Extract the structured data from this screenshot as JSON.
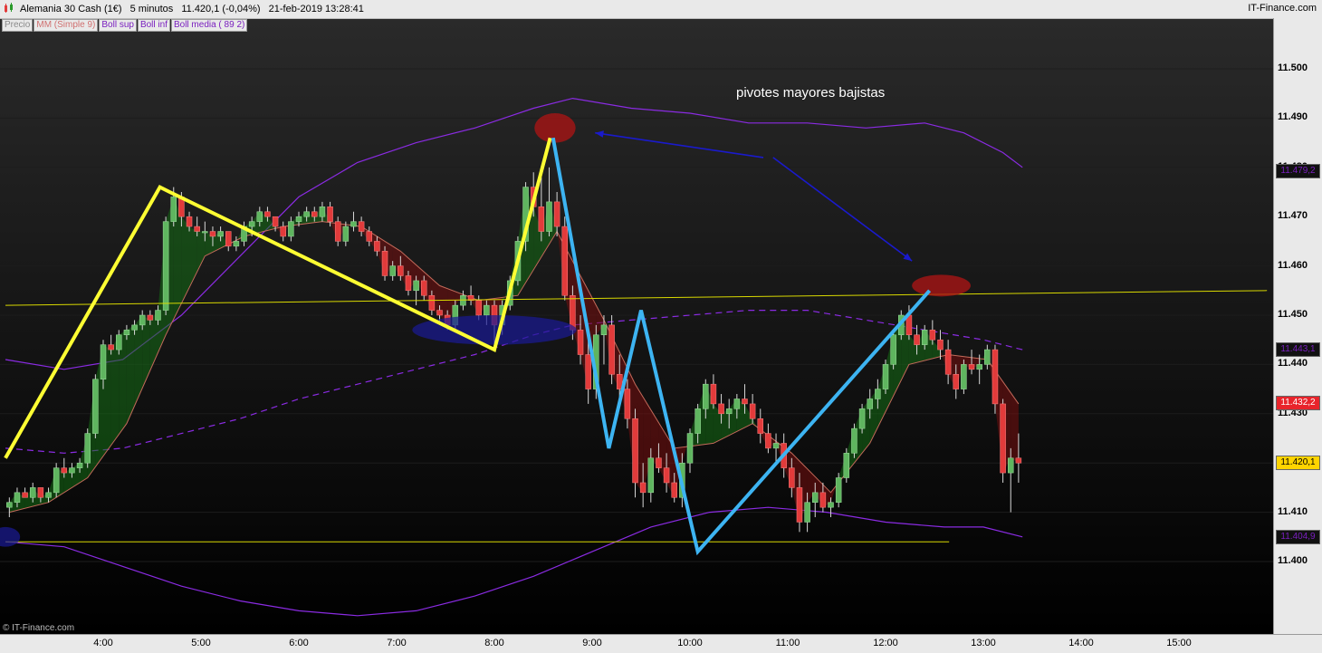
{
  "header": {
    "title": "Alemania 30 Cash (1€)",
    "timeframe": "5 minutos",
    "last": "11.420,1 (-0,04%)",
    "datetime": "21-feb-2019 13:28:41",
    "brand": "IT-Finance.com"
  },
  "legend": {
    "items": [
      {
        "label": "Precio",
        "color": "#8a8a8a"
      },
      {
        "label": "MM (Simple 9)",
        "color": "#d07070"
      },
      {
        "label": "Boll sup",
        "color": "#7a1fbf"
      },
      {
        "label": "Boll inf",
        "color": "#7a1fbf"
      },
      {
        "label": "Boll media ( 89 2)",
        "color": "#7a1fbf"
      }
    ]
  },
  "annotation": "pivotes mayores bajistas",
  "credit": "© IT-Finance.com",
  "colors": {
    "up": "#5fb55f",
    "down": "#e23b3b",
    "boll": "#8a2be2",
    "zigzag_yellow": "#ffff33",
    "zigzag_blue": "#3db4f2",
    "arrow": "#1a1acc",
    "support": "#d8d800"
  },
  "chart_data": {
    "type": "candlestick",
    "symbol": "Alemania 30 Cash (1€)",
    "interval": "5 minutos",
    "y_ticks": [
      "11.500",
      "11.490",
      "11.480",
      "11.470",
      "11.460",
      "11.450",
      "11.440",
      "11.430",
      "11.420",
      "11.410",
      "11.400"
    ],
    "ylim": [
      11389,
      11518
    ],
    "x_ticks": [
      "4:00",
      "5:00",
      "6:00",
      "7:00",
      "8:00",
      "9:00",
      "10:00",
      "11:00",
      "12:00",
      "13:00",
      "14:00",
      "15:00"
    ],
    "x_tick_hours": [
      4,
      5,
      6,
      7,
      8,
      9,
      10,
      11,
      12,
      13,
      14,
      15
    ],
    "xlim": [
      3.0,
      16.0
    ],
    "price_tags": [
      {
        "label": "11.479,2",
        "value": 11479.2,
        "bg": "#111111",
        "fg": "#7a1fbf"
      },
      {
        "label": "11.443,1",
        "value": 11443.1,
        "bg": "#111111",
        "fg": "#7a1fbf"
      },
      {
        "label": "11.432,2",
        "value": 11432.2,
        "bg": "#e8242b",
        "fg": "#ffffff"
      },
      {
        "label": "11.420,1",
        "value": 11420.1,
        "bg": "#ffd400",
        "fg": "#000000"
      },
      {
        "label": "11.404,9",
        "value": 11404.9,
        "bg": "#111111",
        "fg": "#7a1fbf"
      }
    ],
    "candles": [
      [
        3.04,
        11411,
        11413,
        11409,
        11412
      ],
      [
        3.12,
        11412,
        11415,
        11411,
        11414
      ],
      [
        3.2,
        11414,
        11415,
        11413,
        11413
      ],
      [
        3.28,
        11413,
        11416,
        11412,
        11415
      ],
      [
        3.36,
        11415,
        11415,
        11412,
        11413
      ],
      [
        3.44,
        11413,
        11415,
        11412,
        11414
      ],
      [
        3.52,
        11414,
        11420,
        11413,
        11419
      ],
      [
        3.6,
        11419,
        11421,
        11417,
        11418
      ],
      [
        3.68,
        11418,
        11420,
        11417,
        11419
      ],
      [
        3.76,
        11419,
        11421,
        11418,
        11420
      ],
      [
        3.84,
        11420,
        11427,
        11419,
        11426
      ],
      [
        3.92,
        11426,
        11438,
        11425,
        11437
      ],
      [
        4.0,
        11437,
        11445,
        11435,
        11444
      ],
      [
        4.08,
        11444,
        11446,
        11442,
        11443
      ],
      [
        4.16,
        11443,
        11447,
        11442,
        11446
      ],
      [
        4.24,
        11446,
        11448,
        11445,
        11447
      ],
      [
        4.32,
        11447,
        11449,
        11446,
        11448
      ],
      [
        4.4,
        11448,
        11451,
        11447,
        11450
      ],
      [
        4.48,
        11450,
        11451,
        11448,
        11449
      ],
      [
        4.56,
        11449,
        11452,
        11448,
        11451
      ],
      [
        4.64,
        11451,
        11470,
        11450,
        11469
      ],
      [
        4.72,
        11469,
        11476,
        11468,
        11474
      ],
      [
        4.8,
        11474,
        11475,
        11468,
        11470
      ],
      [
        4.88,
        11470,
        11471,
        11467,
        11468
      ],
      [
        4.96,
        11468,
        11470,
        11466,
        11467
      ],
      [
        5.04,
        11467,
        11469,
        11465,
        11467
      ],
      [
        5.12,
        11467,
        11468,
        11464,
        11466
      ],
      [
        5.2,
        11466,
        11468,
        11465,
        11467
      ],
      [
        5.28,
        11467,
        11467,
        11463,
        11464
      ],
      [
        5.36,
        11464,
        11466,
        11463,
        11465
      ],
      [
        5.44,
        11465,
        11469,
        11464,
        11468
      ],
      [
        5.52,
        11468,
        11470,
        11466,
        11469
      ],
      [
        5.6,
        11469,
        11472,
        11468,
        11471
      ],
      [
        5.68,
        11471,
        11472,
        11469,
        11470
      ],
      [
        5.76,
        11470,
        11470,
        11467,
        11468
      ],
      [
        5.84,
        11468,
        11469,
        11465,
        11466
      ],
      [
        5.92,
        11466,
        11470,
        11465,
        11469
      ],
      [
        6.0,
        11469,
        11471,
        11468,
        11470
      ],
      [
        6.08,
        11470,
        11472,
        11469,
        11471
      ],
      [
        6.16,
        11471,
        11472,
        11469,
        11470
      ],
      [
        6.24,
        11470,
        11473,
        11469,
        11472
      ],
      [
        6.32,
        11472,
        11473,
        11468,
        11469
      ],
      [
        6.4,
        11469,
        11470,
        11464,
        11465
      ],
      [
        6.48,
        11465,
        11469,
        11464,
        11468
      ],
      [
        6.56,
        11468,
        11471,
        11467,
        11469
      ],
      [
        6.64,
        11469,
        11470,
        11466,
        11467
      ],
      [
        6.72,
        11467,
        11468,
        11464,
        11465
      ],
      [
        6.8,
        11465,
        11466,
        11462,
        11463
      ],
      [
        6.88,
        11463,
        11464,
        11457,
        11458
      ],
      [
        6.96,
        11458,
        11461,
        11457,
        11460
      ],
      [
        7.04,
        11460,
        11462,
        11457,
        11458
      ],
      [
        7.12,
        11458,
        11459,
        11454,
        11455
      ],
      [
        7.2,
        11455,
        11458,
        11452,
        11457
      ],
      [
        7.28,
        11457,
        11458,
        11453,
        11454
      ],
      [
        7.36,
        11454,
        11455,
        11450,
        11451
      ],
      [
        7.44,
        11451,
        11452,
        11448,
        11450
      ],
      [
        7.52,
        11450,
        11451,
        11447,
        11448
      ],
      [
        7.6,
        11448,
        11453,
        11447,
        11452
      ],
      [
        7.68,
        11452,
        11455,
        11451,
        11454
      ],
      [
        7.76,
        11454,
        11456,
        11452,
        11453
      ],
      [
        7.84,
        11453,
        11454,
        11449,
        11450
      ],
      [
        7.92,
        11450,
        11453,
        11448,
        11452
      ],
      [
        8.0,
        11452,
        11453,
        11444,
        11448
      ],
      [
        8.08,
        11448,
        11453,
        11446,
        11452
      ],
      [
        8.16,
        11452,
        11458,
        11451,
        11457
      ],
      [
        8.24,
        11457,
        11466,
        11456,
        11465
      ],
      [
        8.32,
        11465,
        11477,
        11463,
        11476
      ],
      [
        8.4,
        11476,
        11479,
        11470,
        11472
      ],
      [
        8.48,
        11472,
        11478,
        11465,
        11467
      ],
      [
        8.56,
        11467,
        11480,
        11466,
        11473
      ],
      [
        8.64,
        11473,
        11475,
        11466,
        11468
      ],
      [
        8.72,
        11468,
        11470,
        11453,
        11454
      ],
      [
        8.8,
        11454,
        11456,
        11445,
        11447
      ],
      [
        8.88,
        11447,
        11450,
        11440,
        11442
      ],
      [
        8.96,
        11442,
        11446,
        11432,
        11435
      ],
      [
        9.04,
        11435,
        11448,
        11433,
        11446
      ],
      [
        9.12,
        11446,
        11450,
        11440,
        11448
      ],
      [
        9.2,
        11448,
        11450,
        11436,
        11438
      ],
      [
        9.28,
        11438,
        11442,
        11433,
        11435
      ],
      [
        9.36,
        11435,
        11437,
        11427,
        11429
      ],
      [
        9.44,
        11429,
        11431,
        11413,
        11416
      ],
      [
        9.52,
        11416,
        11420,
        11411,
        11414
      ],
      [
        9.6,
        11414,
        11423,
        11412,
        11421
      ],
      [
        9.68,
        11421,
        11424,
        11418,
        11419
      ],
      [
        9.76,
        11419,
        11422,
        11414,
        11416
      ],
      [
        9.84,
        11416,
        11418,
        11412,
        11413
      ],
      [
        9.92,
        11413,
        11422,
        11411,
        11420
      ],
      [
        10.0,
        11420,
        11427,
        11418,
        11426
      ],
      [
        10.08,
        11426,
        11432,
        11424,
        11431
      ],
      [
        10.16,
        11431,
        11437,
        11429,
        11436
      ],
      [
        10.24,
        11436,
        11438,
        11431,
        11432
      ],
      [
        10.32,
        11432,
        11434,
        11428,
        11430
      ],
      [
        10.4,
        11430,
        11433,
        11427,
        11431
      ],
      [
        10.48,
        11431,
        11434,
        11429,
        11433
      ],
      [
        10.56,
        11433,
        11436,
        11430,
        11432
      ],
      [
        10.64,
        11432,
        11434,
        11428,
        11429
      ],
      [
        10.72,
        11429,
        11431,
        11424,
        11426
      ],
      [
        10.8,
        11426,
        11428,
        11422,
        11423
      ],
      [
        10.88,
        11423,
        11426,
        11420,
        11424
      ],
      [
        10.96,
        11424,
        11426,
        11417,
        11419
      ],
      [
        11.04,
        11419,
        11421,
        11413,
        11415
      ],
      [
        11.12,
        11415,
        11418,
        11406,
        11408
      ],
      [
        11.2,
        11408,
        11414,
        11406,
        11412
      ],
      [
        11.28,
        11412,
        11416,
        11409,
        11414
      ],
      [
        11.36,
        11414,
        11416,
        11410,
        11411
      ],
      [
        11.44,
        11411,
        11413,
        11409,
        11412
      ],
      [
        11.52,
        11412,
        11418,
        11411,
        11417
      ],
      [
        11.6,
        11417,
        11423,
        11416,
        11422
      ],
      [
        11.68,
        11422,
        11428,
        11421,
        11427
      ],
      [
        11.76,
        11427,
        11432,
        11426,
        11431
      ],
      [
        11.84,
        11431,
        11435,
        11429,
        11433
      ],
      [
        11.92,
        11433,
        11437,
        11431,
        11435
      ],
      [
        12.0,
        11435,
        11441,
        11434,
        11440
      ],
      [
        12.08,
        11440,
        11447,
        11439,
        11446
      ],
      [
        12.16,
        11446,
        11451,
        11445,
        11450
      ],
      [
        12.24,
        11450,
        11452,
        11445,
        11446
      ],
      [
        12.32,
        11446,
        11448,
        11442,
        11444
      ],
      [
        12.4,
        11444,
        11448,
        11443,
        11447
      ],
      [
        12.48,
        11447,
        11449,
        11444,
        11445
      ],
      [
        12.56,
        11445,
        11447,
        11441,
        11443
      ],
      [
        12.64,
        11443,
        11445,
        11436,
        11438
      ],
      [
        12.72,
        11438,
        11440,
        11433,
        11435
      ],
      [
        12.8,
        11435,
        11441,
        11434,
        11440
      ],
      [
        12.88,
        11440,
        11443,
        11438,
        11439
      ],
      [
        12.96,
        11439,
        11442,
        11436,
        11440
      ],
      [
        13.04,
        11440,
        11444,
        11439,
        11443
      ],
      [
        13.12,
        11443,
        11444,
        11430,
        11432
      ],
      [
        13.2,
        11432,
        11433,
        11416,
        11418
      ],
      [
        13.28,
        11418,
        11423,
        11410,
        11421
      ],
      [
        13.36,
        11421,
        11426,
        11416,
        11420
      ]
    ],
    "sma9": [
      [
        3.04,
        11410
      ],
      [
        3.44,
        11412
      ],
      [
        3.84,
        11417
      ],
      [
        4.24,
        11428
      ],
      [
        4.64,
        11446
      ],
      [
        5.04,
        11462
      ],
      [
        5.44,
        11466
      ],
      [
        5.84,
        11468
      ],
      [
        6.24,
        11469
      ],
      [
        6.64,
        11468
      ],
      [
        7.04,
        11463
      ],
      [
        7.44,
        11456
      ],
      [
        7.84,
        11453
      ],
      [
        8.24,
        11454
      ],
      [
        8.64,
        11467
      ],
      [
        8.88,
        11458
      ],
      [
        9.12,
        11449
      ],
      [
        9.44,
        11436
      ],
      [
        9.84,
        11423
      ],
      [
        10.24,
        11424
      ],
      [
        10.64,
        11428
      ],
      [
        11.04,
        11422
      ],
      [
        11.44,
        11414
      ],
      [
        11.84,
        11424
      ],
      [
        12.24,
        11440
      ],
      [
        12.64,
        11442
      ],
      [
        13.04,
        11441
      ],
      [
        13.36,
        11432
      ]
    ],
    "boll_sup": [
      [
        3.0,
        11441
      ],
      [
        3.6,
        11439
      ],
      [
        4.2,
        11441
      ],
      [
        4.8,
        11450
      ],
      [
        5.4,
        11462
      ],
      [
        6.0,
        11474
      ],
      [
        6.6,
        11481
      ],
      [
        7.2,
        11485
      ],
      [
        7.8,
        11488
      ],
      [
        8.4,
        11492
      ],
      [
        8.8,
        11494
      ],
      [
        9.4,
        11492
      ],
      [
        10.0,
        11491
      ],
      [
        10.6,
        11489
      ],
      [
        11.2,
        11489
      ],
      [
        11.8,
        11488
      ],
      [
        12.4,
        11489
      ],
      [
        12.8,
        11487
      ],
      [
        13.2,
        11483
      ],
      [
        13.4,
        11480
      ]
    ],
    "boll_inf": [
      [
        3.0,
        11404
      ],
      [
        3.6,
        11403
      ],
      [
        4.2,
        11399
      ],
      [
        4.8,
        11395
      ],
      [
        5.4,
        11392
      ],
      [
        6.0,
        11390
      ],
      [
        6.6,
        11389
      ],
      [
        7.2,
        11390
      ],
      [
        7.8,
        11393
      ],
      [
        8.4,
        11397
      ],
      [
        9.0,
        11402
      ],
      [
        9.6,
        11407
      ],
      [
        10.2,
        11410
      ],
      [
        10.8,
        11411
      ],
      [
        11.4,
        11410
      ],
      [
        12.0,
        11408
      ],
      [
        12.6,
        11407
      ],
      [
        13.0,
        11407
      ],
      [
        13.4,
        11405
      ]
    ],
    "boll_media": [
      [
        3.0,
        11423
      ],
      [
        3.6,
        11422
      ],
      [
        4.2,
        11423
      ],
      [
        4.8,
        11426
      ],
      [
        5.4,
        11429
      ],
      [
        6.0,
        11433
      ],
      [
        6.6,
        11436
      ],
      [
        7.2,
        11439
      ],
      [
        7.8,
        11442
      ],
      [
        8.4,
        11446
      ],
      [
        8.8,
        11448
      ],
      [
        9.4,
        11449
      ],
      [
        10.0,
        11450
      ],
      [
        10.6,
        11451
      ],
      [
        11.2,
        11451
      ],
      [
        11.8,
        11449
      ],
      [
        12.4,
        11447
      ],
      [
        13.0,
        11445
      ],
      [
        13.4,
        11443
      ]
    ],
    "support_lines": [
      {
        "points": [
          [
            3.0,
            11452
          ],
          [
            15.9,
            11455
          ]
        ]
      },
      {
        "points": [
          [
            3.0,
            11404
          ],
          [
            12.65,
            11404
          ]
        ]
      }
    ],
    "zigzag_yellow": [
      [
        3.0,
        11421
      ],
      [
        4.58,
        11476
      ],
      [
        4.68,
        11475
      ],
      [
        8.0,
        11443
      ],
      [
        8.57,
        11486
      ]
    ],
    "zigzag_blue": [
      [
        8.6,
        11486
      ],
      [
        9.17,
        11423
      ],
      [
        9.5,
        11451
      ],
      [
        10.08,
        11402
      ],
      [
        12.45,
        11455
      ]
    ],
    "arrows": [
      [
        [
          10.75,
          11482
        ],
        [
          9.03,
          11487
        ]
      ],
      [
        [
          10.85,
          11482
        ],
        [
          12.27,
          11461
        ]
      ]
    ],
    "ellipses": [
      {
        "cx": 8.62,
        "cy": 11488,
        "rx": 0.21,
        "ry": 3,
        "fill": "rgba(170,20,20,0.78)"
      },
      {
        "cx": 12.57,
        "cy": 11456,
        "rx": 0.3,
        "ry": 2.2,
        "fill": "rgba(170,20,20,0.78)"
      },
      {
        "cx": 8.0,
        "cy": 11447,
        "rx": 0.84,
        "ry": 3,
        "fill": "rgba(25,25,150,0.7)"
      },
      {
        "cx": 3.0,
        "cy": 11405,
        "rx": 0.15,
        "ry": 2,
        "fill": "rgba(25,25,150,0.7)"
      }
    ]
  }
}
